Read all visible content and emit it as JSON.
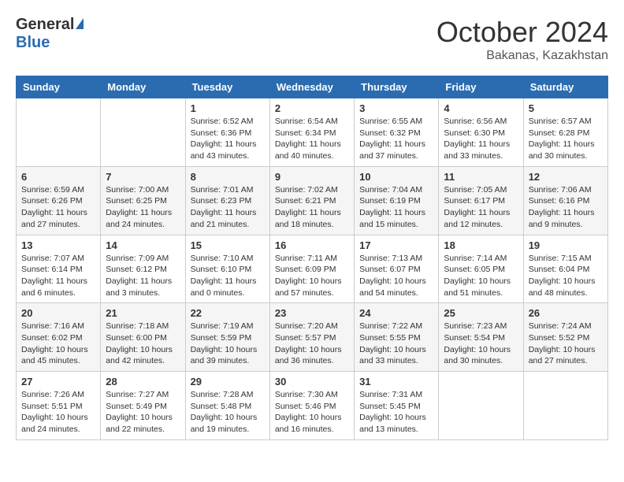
{
  "logo": {
    "line1": "General",
    "line2": "Blue"
  },
  "header": {
    "month": "October 2024",
    "location": "Bakanas, Kazakhstan"
  },
  "weekdays": [
    "Sunday",
    "Monday",
    "Tuesday",
    "Wednesday",
    "Thursday",
    "Friday",
    "Saturday"
  ],
  "weeks": [
    [
      {
        "day": null
      },
      {
        "day": null
      },
      {
        "day": "1",
        "sunrise": "Sunrise: 6:52 AM",
        "sunset": "Sunset: 6:36 PM",
        "daylight": "Daylight: 11 hours and 43 minutes."
      },
      {
        "day": "2",
        "sunrise": "Sunrise: 6:54 AM",
        "sunset": "Sunset: 6:34 PM",
        "daylight": "Daylight: 11 hours and 40 minutes."
      },
      {
        "day": "3",
        "sunrise": "Sunrise: 6:55 AM",
        "sunset": "Sunset: 6:32 PM",
        "daylight": "Daylight: 11 hours and 37 minutes."
      },
      {
        "day": "4",
        "sunrise": "Sunrise: 6:56 AM",
        "sunset": "Sunset: 6:30 PM",
        "daylight": "Daylight: 11 hours and 33 minutes."
      },
      {
        "day": "5",
        "sunrise": "Sunrise: 6:57 AM",
        "sunset": "Sunset: 6:28 PM",
        "daylight": "Daylight: 11 hours and 30 minutes."
      }
    ],
    [
      {
        "day": "6",
        "sunrise": "Sunrise: 6:59 AM",
        "sunset": "Sunset: 6:26 PM",
        "daylight": "Daylight: 11 hours and 27 minutes."
      },
      {
        "day": "7",
        "sunrise": "Sunrise: 7:00 AM",
        "sunset": "Sunset: 6:25 PM",
        "daylight": "Daylight: 11 hours and 24 minutes."
      },
      {
        "day": "8",
        "sunrise": "Sunrise: 7:01 AM",
        "sunset": "Sunset: 6:23 PM",
        "daylight": "Daylight: 11 hours and 21 minutes."
      },
      {
        "day": "9",
        "sunrise": "Sunrise: 7:02 AM",
        "sunset": "Sunset: 6:21 PM",
        "daylight": "Daylight: 11 hours and 18 minutes."
      },
      {
        "day": "10",
        "sunrise": "Sunrise: 7:04 AM",
        "sunset": "Sunset: 6:19 PM",
        "daylight": "Daylight: 11 hours and 15 minutes."
      },
      {
        "day": "11",
        "sunrise": "Sunrise: 7:05 AM",
        "sunset": "Sunset: 6:17 PM",
        "daylight": "Daylight: 11 hours and 12 minutes."
      },
      {
        "day": "12",
        "sunrise": "Sunrise: 7:06 AM",
        "sunset": "Sunset: 6:16 PM",
        "daylight": "Daylight: 11 hours and 9 minutes."
      }
    ],
    [
      {
        "day": "13",
        "sunrise": "Sunrise: 7:07 AM",
        "sunset": "Sunset: 6:14 PM",
        "daylight": "Daylight: 11 hours and 6 minutes."
      },
      {
        "day": "14",
        "sunrise": "Sunrise: 7:09 AM",
        "sunset": "Sunset: 6:12 PM",
        "daylight": "Daylight: 11 hours and 3 minutes."
      },
      {
        "day": "15",
        "sunrise": "Sunrise: 7:10 AM",
        "sunset": "Sunset: 6:10 PM",
        "daylight": "Daylight: 11 hours and 0 minutes."
      },
      {
        "day": "16",
        "sunrise": "Sunrise: 7:11 AM",
        "sunset": "Sunset: 6:09 PM",
        "daylight": "Daylight: 10 hours and 57 minutes."
      },
      {
        "day": "17",
        "sunrise": "Sunrise: 7:13 AM",
        "sunset": "Sunset: 6:07 PM",
        "daylight": "Daylight: 10 hours and 54 minutes."
      },
      {
        "day": "18",
        "sunrise": "Sunrise: 7:14 AM",
        "sunset": "Sunset: 6:05 PM",
        "daylight": "Daylight: 10 hours and 51 minutes."
      },
      {
        "day": "19",
        "sunrise": "Sunrise: 7:15 AM",
        "sunset": "Sunset: 6:04 PM",
        "daylight": "Daylight: 10 hours and 48 minutes."
      }
    ],
    [
      {
        "day": "20",
        "sunrise": "Sunrise: 7:16 AM",
        "sunset": "Sunset: 6:02 PM",
        "daylight": "Daylight: 10 hours and 45 minutes."
      },
      {
        "day": "21",
        "sunrise": "Sunrise: 7:18 AM",
        "sunset": "Sunset: 6:00 PM",
        "daylight": "Daylight: 10 hours and 42 minutes."
      },
      {
        "day": "22",
        "sunrise": "Sunrise: 7:19 AM",
        "sunset": "Sunset: 5:59 PM",
        "daylight": "Daylight: 10 hours and 39 minutes."
      },
      {
        "day": "23",
        "sunrise": "Sunrise: 7:20 AM",
        "sunset": "Sunset: 5:57 PM",
        "daylight": "Daylight: 10 hours and 36 minutes."
      },
      {
        "day": "24",
        "sunrise": "Sunrise: 7:22 AM",
        "sunset": "Sunset: 5:55 PM",
        "daylight": "Daylight: 10 hours and 33 minutes."
      },
      {
        "day": "25",
        "sunrise": "Sunrise: 7:23 AM",
        "sunset": "Sunset: 5:54 PM",
        "daylight": "Daylight: 10 hours and 30 minutes."
      },
      {
        "day": "26",
        "sunrise": "Sunrise: 7:24 AM",
        "sunset": "Sunset: 5:52 PM",
        "daylight": "Daylight: 10 hours and 27 minutes."
      }
    ],
    [
      {
        "day": "27",
        "sunrise": "Sunrise: 7:26 AM",
        "sunset": "Sunset: 5:51 PM",
        "daylight": "Daylight: 10 hours and 24 minutes."
      },
      {
        "day": "28",
        "sunrise": "Sunrise: 7:27 AM",
        "sunset": "Sunset: 5:49 PM",
        "daylight": "Daylight: 10 hours and 22 minutes."
      },
      {
        "day": "29",
        "sunrise": "Sunrise: 7:28 AM",
        "sunset": "Sunset: 5:48 PM",
        "daylight": "Daylight: 10 hours and 19 minutes."
      },
      {
        "day": "30",
        "sunrise": "Sunrise: 7:30 AM",
        "sunset": "Sunset: 5:46 PM",
        "daylight": "Daylight: 10 hours and 16 minutes."
      },
      {
        "day": "31",
        "sunrise": "Sunrise: 7:31 AM",
        "sunset": "Sunset: 5:45 PM",
        "daylight": "Daylight: 10 hours and 13 minutes."
      },
      {
        "day": null
      },
      {
        "day": null
      }
    ]
  ]
}
